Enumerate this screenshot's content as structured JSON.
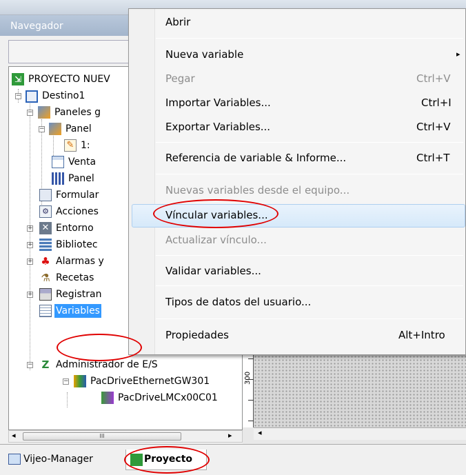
{
  "navigator": {
    "title": "Navegador"
  },
  "tree": {
    "items": [
      {
        "label": "PROYECTO NUEV",
        "icon": "project-icon"
      },
      {
        "label": "Destino1",
        "icon": "target-icon"
      },
      {
        "label": "Paneles g",
        "icon": "panels-folder-icon"
      },
      {
        "label": "Panel",
        "icon": "panel-folder-icon"
      },
      {
        "label": "1:",
        "icon": "panel-page-icon"
      },
      {
        "label": "Venta",
        "icon": "window-icon"
      },
      {
        "label": "Panel",
        "icon": "panel-icon"
      },
      {
        "label": "Formular",
        "icon": "form-icon"
      },
      {
        "label": "Acciones",
        "icon": "actions-icon"
      },
      {
        "label": "Entorno",
        "icon": "environment-icon"
      },
      {
        "label": "Bibliotec",
        "icon": "library-icon"
      },
      {
        "label": "Alarmas y",
        "icon": "alarms-icon"
      },
      {
        "label": "Recetas",
        "icon": "recipes-icon"
      },
      {
        "label": "Registran",
        "icon": "logging-icon"
      },
      {
        "label": "Variables",
        "icon": "variables-icon"
      },
      {
        "label": "Administrador de E/S",
        "icon": "io-manager-icon"
      },
      {
        "label": "PacDriveEthernetGW301",
        "icon": "driver-icon"
      },
      {
        "label": "PacDriveLMCx00C01",
        "icon": "equipment-icon"
      }
    ]
  },
  "scrollbar": {
    "thumb_label": "III"
  },
  "ruler": {
    "label": "300"
  },
  "tabs": [
    {
      "label": "Vijeo-Manager",
      "icon": "vijeo-manager-icon"
    },
    {
      "label": "Proyecto",
      "icon": "project-tab-icon"
    }
  ],
  "context_menu": {
    "items": [
      {
        "label": "Abrir",
        "shortcut": ""
      },
      {
        "label": "Nueva variable",
        "shortcut": "▸"
      },
      {
        "label": "Pegar",
        "shortcut": "Ctrl+V"
      },
      {
        "label": "Importar Variables...",
        "shortcut": "Ctrl+I"
      },
      {
        "label": "Exportar Variables...",
        "shortcut": "Ctrl+V"
      },
      {
        "label": "Referencia de variable & Informe...",
        "shortcut": "Ctrl+T"
      },
      {
        "label": "Nuevas variables desde el equipo...",
        "shortcut": ""
      },
      {
        "label": "Víncular variables...",
        "shortcut": ""
      },
      {
        "label": "Actualizar vínculo...",
        "shortcut": ""
      },
      {
        "label": "Validar variables...",
        "shortcut": ""
      },
      {
        "label": "Tipos de datos del usuario...",
        "shortcut": ""
      },
      {
        "label": "Propiedades",
        "shortcut": "Alt+Intro"
      }
    ]
  },
  "colors": {
    "annotation": "#e00000",
    "highlight": "#d6e9fa",
    "selection": "#3399ff"
  }
}
